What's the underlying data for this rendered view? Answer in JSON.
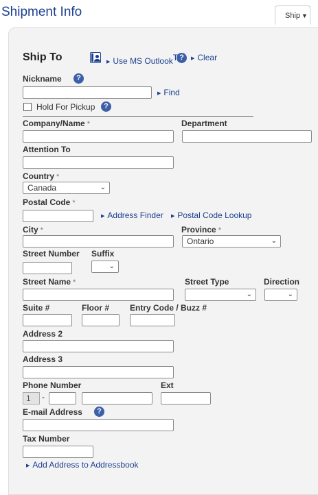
{
  "header": {
    "title": "Shipment Info",
    "ship_tab_label": "Ship"
  },
  "form": {
    "heading": "Ship To",
    "use_outlook_label": "Use MS Outlook",
    "use_outlook_sup": "TM",
    "clear_label": "Clear",
    "nickname_label": "Nickname",
    "find_label": "Find",
    "hold_for_pickup_label": "Hold For Pickup",
    "company_label": "Company/Name",
    "department_label": "Department",
    "attention_label": "Attention To",
    "country_label": "Country",
    "country_value": "Canada",
    "postal_code_label": "Postal Code",
    "address_finder_label": "Address Finder",
    "postal_lookup_label": "Postal Code Lookup",
    "city_label": "City",
    "province_label": "Province",
    "province_value": "Ontario",
    "street_number_label": "Street Number",
    "suffix_label": "Suffix",
    "street_name_label": "Street Name",
    "street_type_label": "Street Type",
    "direction_label": "Direction",
    "suite_label": "Suite #",
    "floor_label": "Floor #",
    "entry_code_label": "Entry Code / Buzz #",
    "address2_label": "Address 2",
    "address3_label": "Address 3",
    "phone_label": "Phone Number",
    "phone_prefix": "1",
    "ext_label": "Ext",
    "email_label": "E-mail Address",
    "tax_label": "Tax Number",
    "add_address_label": "Add Address to Addressbook",
    "required_mark": "*",
    "help_glyph": "?"
  },
  "icons": {
    "outlook": "address-book-icon",
    "help": "help-circle-icon",
    "link_arrow": "triangle-right-icon",
    "dropdown": "chevron-down-icon"
  },
  "colors": {
    "brand": "#1b3f8f",
    "panel_bg": "#f3f3f3",
    "help_bg": "#3c5fa8"
  }
}
